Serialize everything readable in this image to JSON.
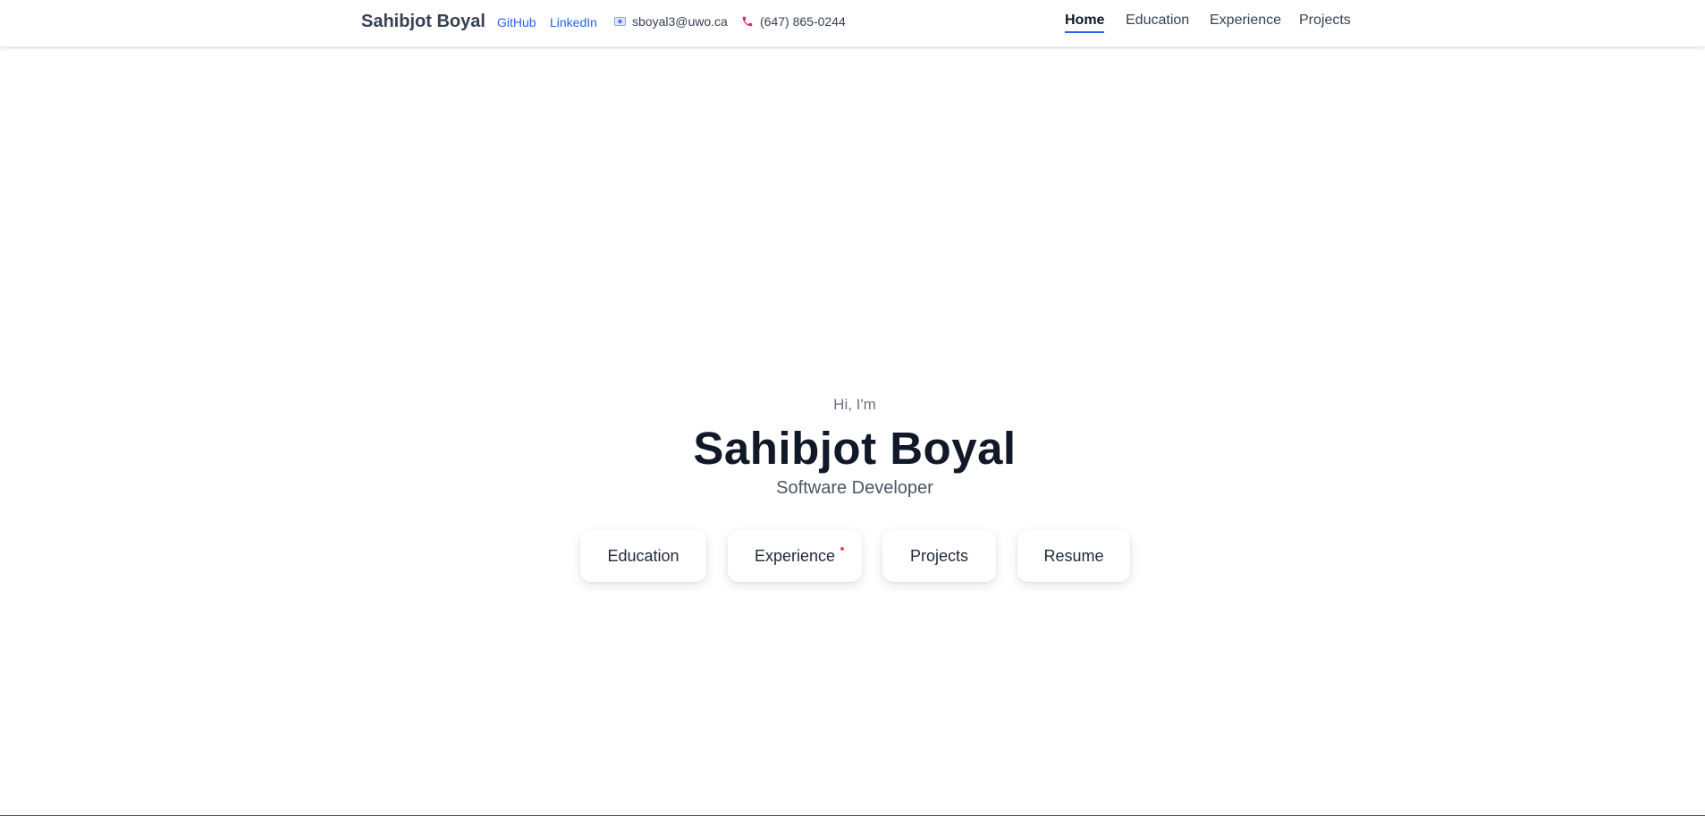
{
  "header": {
    "brand": "Sahibjot Boyal",
    "links": {
      "github": "GitHub",
      "linkedin": "LinkedIn"
    },
    "contact": {
      "email": "sboyal3@uwo.ca",
      "email_icon": "envelope-icon",
      "phone": "(647) 865-0244",
      "phone_icon": "phone-icon"
    },
    "nav": {
      "home": "Home",
      "education": "Education",
      "experience": "Experience",
      "projects": "Projects",
      "active": "Home"
    }
  },
  "hero": {
    "greeting": "Hi, I'm",
    "name": "Sahibjot Boyal",
    "role": "Software Developer",
    "cards": {
      "education": "Education",
      "experience": "Experience",
      "projects": "Projects",
      "resume": "Resume"
    }
  },
  "colors": {
    "accent": "#2563eb",
    "text_dark": "#111827",
    "text_muted": "#6b7280",
    "phone_icon": "#db2777",
    "notification_dot": "#ef4444"
  }
}
